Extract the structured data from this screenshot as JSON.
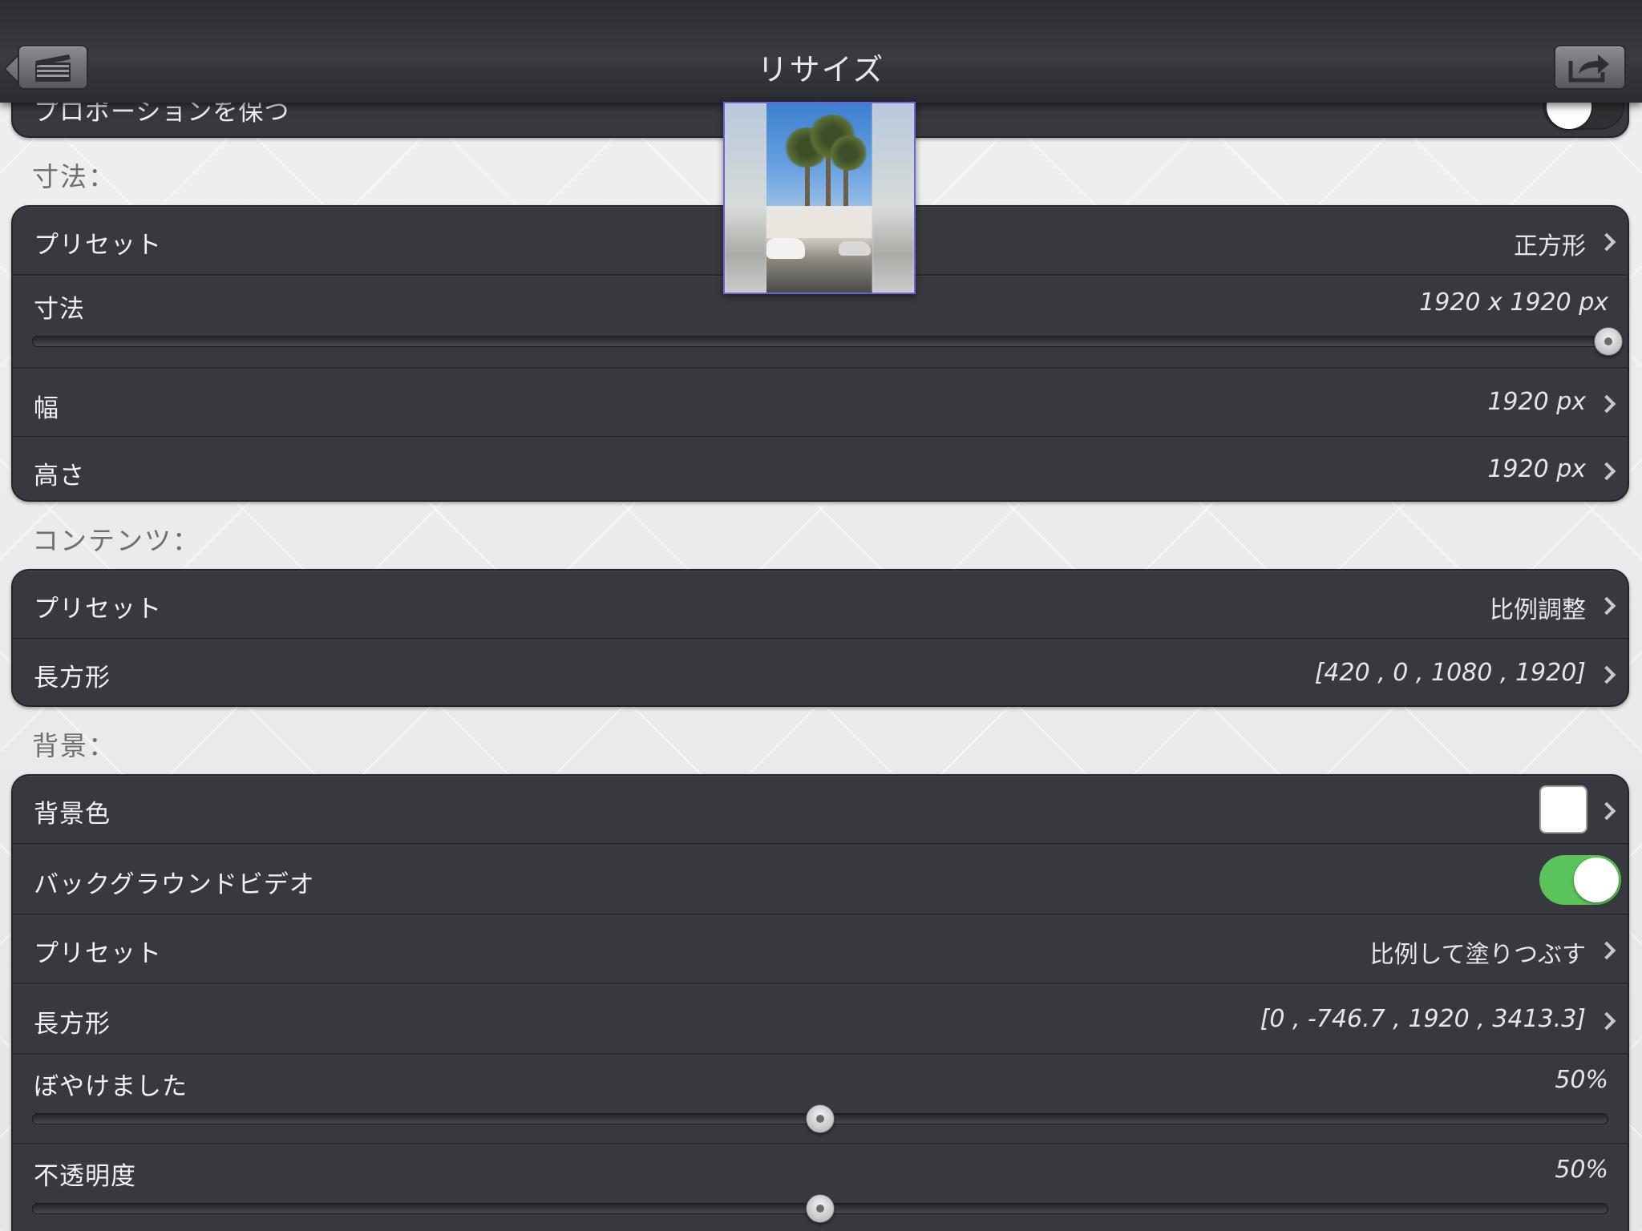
{
  "nav": {
    "title": "リサイズ",
    "back_icon": "clapperboard-icon",
    "share_icon": "share-icon"
  },
  "top_partial": {
    "label": "プロポーションを保つ",
    "toggle_on": false
  },
  "dimensions_section": {
    "heading": "寸法：",
    "preset_label": "プリセット",
    "preset_value": "正方形",
    "size_label": "寸法",
    "size_value": "1920 x 1920 px",
    "size_slider_fraction": 1.0,
    "width_label": "幅",
    "width_value": "1920 px",
    "height_label": "高さ",
    "height_value": "1920 px"
  },
  "content_section": {
    "heading": "コンテンツ：",
    "preset_label": "プリセット",
    "preset_value": "比例調整",
    "rect_label": "長方形",
    "rect_value": "[420 , 0 , 1080 , 1920]"
  },
  "background_section": {
    "heading": "背景：",
    "color_label": "背景色",
    "color_value": "#ffffff",
    "video_label": "バックグラウンドビデオ",
    "video_toggle_on": true,
    "preset_label": "プリセット",
    "preset_value": "比例して塗りつぶす",
    "rect_label": "長方形",
    "rect_value": "[0 , -746.7 , 1920 , 3413.3]",
    "blur_label": "ぼやけました",
    "blur_value": "50%",
    "blur_fraction": 0.5,
    "opacity_label": "不透明度",
    "opacity_value": "50%",
    "opacity_fraction": 0.5
  },
  "colors": {
    "toggle_on": "#5ac45a",
    "card": "#38393f",
    "preview_border": "#6f63d8"
  }
}
